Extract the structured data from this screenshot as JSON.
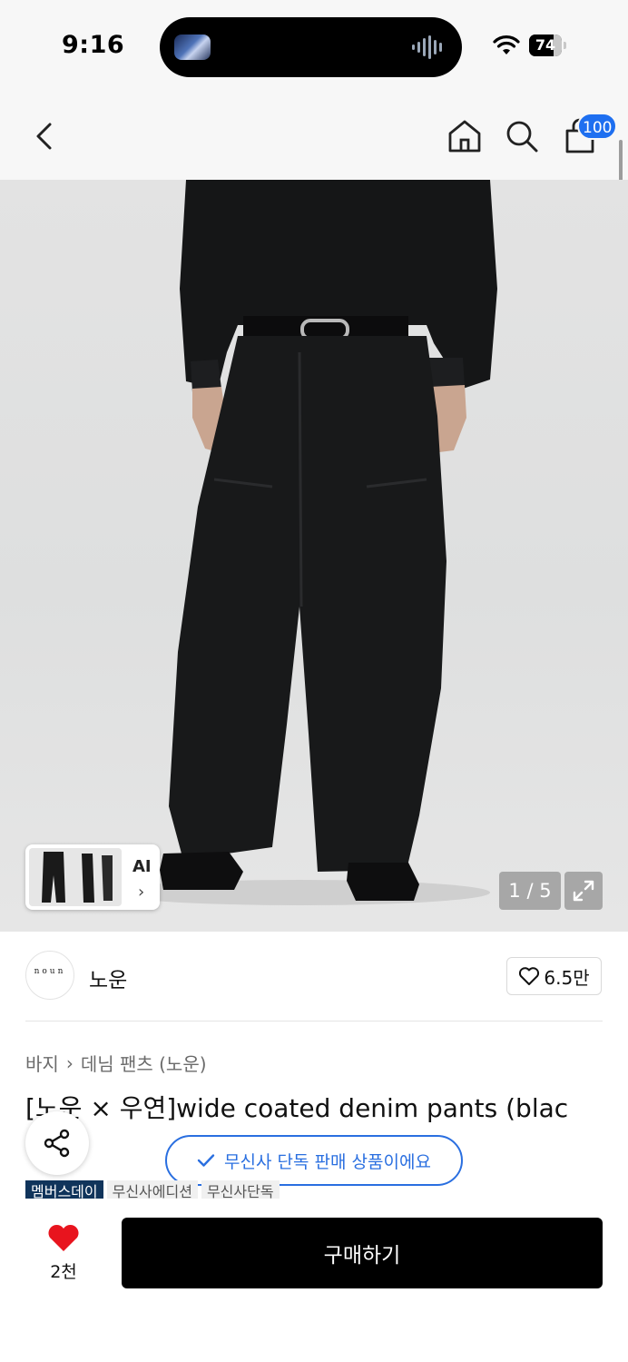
{
  "status_bar": {
    "time": "9:16",
    "battery": "74",
    "battery_level": 0.74
  },
  "nav": {
    "cart_count": "100"
  },
  "gallery": {
    "counter": "1 / 5",
    "thumb_label": "AI"
  },
  "brand": {
    "logo_text": "noun",
    "name": "노운",
    "likes": "6.5만"
  },
  "breadcrumb": {
    "category": "바지",
    "subcategory": "데님 팬츠 (노운)"
  },
  "product": {
    "title": "[노운 × 우연]wide coated denim pants (blac",
    "exclusive": "무신사 단독 판매 상품이에요",
    "tags": [
      "멤버스데이",
      "무신사에디션",
      "무신사단독"
    ]
  },
  "bottom": {
    "wish_count": "2천",
    "buy_label": "구매하기"
  },
  "colors": {
    "accent": "#1e6ff0",
    "pill": "#2a6fe0",
    "heart": "#e8141e",
    "tag_dark": "#10345b"
  }
}
